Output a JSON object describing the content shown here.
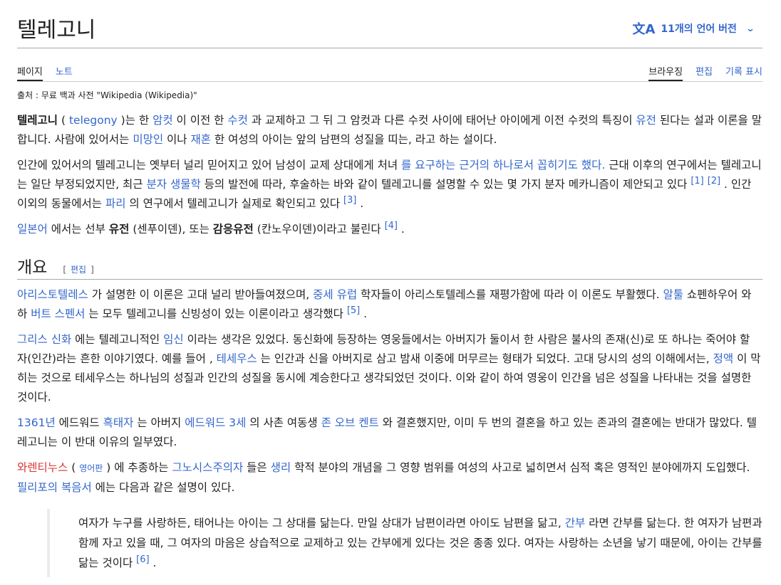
{
  "article": {
    "title": "텔레고니",
    "lang_icon": "文A",
    "lang_label": "11개의 언어 버전",
    "lang_chevron": "⌄"
  },
  "tabs": {
    "left": [
      "페이지",
      "노트"
    ],
    "right": [
      "브라우징",
      "편집",
      "기록 표시"
    ]
  },
  "from": "출처 : 무료 백과 사전 \"Wikipedia (Wikipedia)\"",
  "intro": {
    "p1": {
      "term": "텔레고니",
      "s1": " ( ",
      "l1": "telegony",
      "s2": " )는 한 ",
      "l2": "암컷",
      "s3": " 이 이전 한 ",
      "l3": "수컷",
      "s4": " 과 교제하고 그 뒤 그 암컷과 다른 수컷 사이에 태어난 아이에게 이전 수컷의 특징이 ",
      "l4": "유전",
      "s5": " 된다는 설과 이론을 말합니다. 사람에 있어서는 ",
      "l5": "미망인",
      "s6": " 이나 ",
      "l6": "재혼",
      "s7": " 한 여성의 아이는 앞의 남편의 성질을 띠는, 라고 하는 설이다."
    },
    "p2": {
      "s1": "인간에 있어서의 텔레고니는 옛부터 널리 믿어지고 있어 남성이 교제 상대에게 처녀 ",
      "l1": "를 요구하는 근거의 하나로서 꼽히기도 했다.",
      "s2": " 근대 이후의 연구에서는 텔레고니는 일단 부정되었지만, 최근 ",
      "l2": "분자 생물학",
      "s3": " 등의 발전에 따라, 후술하는 바와 같이 텔레고니를 설명할 수 있는 몇 가지 분자 메카니즘이 제안되고 있다 ",
      "r1": "[1]",
      "r2": "[2]",
      "s4": " . 인간 이외의 동물에서는 ",
      "l3": "파리",
      "s5": " 의 연구에서 텔레고니가 실제로 확인되고 있다 ",
      "r3": "[3]",
      "s6": " ."
    },
    "p3": {
      "l1": "일본어",
      "s1": " 에서는 선부 ",
      "b1": "유전",
      "s2": " (센푸이덴), 또는 ",
      "b2": "감응유전",
      "s3": " (칸노우이덴)이라고 불린다 ",
      "r1": "[4]",
      "s4": " ."
    }
  },
  "section": {
    "title": "개요",
    "edit_open": "[",
    "edit": "편집",
    "edit_close": "]",
    "p1": {
      "l1": "아리스토텔레스",
      "s1": " 가 설명한 이 이론은 고대 널리 받아들여졌으며, ",
      "l2": "중세 유럽",
      "s2": " 학자들이 아리스토텔레스를 재평가함에 따라 이 이론도 부활했다. ",
      "l3": "알툴",
      "s3": " 쇼펜하우어 와 하 ",
      "l4": "버트 스펜서",
      "s4": " 는 모두 텔레고니를 신빙성이 있는 이론이라고 생각했다 ",
      "r1": "[5]",
      "s5": " ."
    },
    "p2": {
      "l1": "그리스 신화",
      "s1": " 에는 텔레고니적인 ",
      "l2": "임신",
      "s2": " 이라는 생각은 있었다. 동신화에 등장하는 영웅들에서는 아버지가 둘이서 한 사람은 불사의 존재(신)로 또 하나는 죽어야 할 자(인간)라는 흔한 이야기였다. 예를 들어 , ",
      "l3": "테세우스",
      "s3": " 는 인간과 신을 아버지로 삼고 밤새 이중에 머무르는 형태가 되었다. 고대 당시의 성의 이해에서는, ",
      "l4": "정액",
      "s4": " 이 막히는 것으로 테세우스는 하나님의 성질과 인간의 성질을 동시에 계승한다고 생각되었던 것이다. 이와 같이 하여 영웅이 인간을 넘은 성질을 나타내는 것을 설명한 것이다."
    },
    "p3": {
      "l1": "1361년",
      "s1": " 에드워드 ",
      "l2": "흑태자",
      "s2": " 는 아버지 ",
      "l3": "에드워드 3세",
      "s3": " 의 사촌 여동생 ",
      "l4": "존 오브 켄트",
      "s4": " 와 결혼했지만, 이미 두 번의 결혼을 하고 있는 존과의 결혼에는 반대가 많았다. 텔레고니는 이 반대 이유의 일부였다."
    },
    "p4": {
      "red1": "와렌티누스",
      "s0": " ( ",
      "small1": "영어판",
      "s0b": " ) 에 추종하는 ",
      "l1": "그노시스주의자",
      "s1": " 들은 ",
      "l2": "생리",
      "s2": " 학적 분야의 개념을 그 영향 범위를 여성의 사고로 넓히면서 심적 혹은 영적인 분야에까지 도입했다. ",
      "l3": "필리포의 복음서",
      "s3": " 에는 다음과 같은 설명이 있다."
    },
    "quote": {
      "s1": "여자가 누구를 사랑하든, 태어나는 아이는 그 상대를 닮는다. 만일 상대가 남편이라면 아이도 남편을 닮고, ",
      "l1": "간부",
      "s2": " 라면 간부를 닮는다. 한 여자가 남편과 함께 자고 있을 때, 그 여자의 마음은 상습적으로 교제하고 있는 간부에게 있다는 것은 종종 있다. 여자는 사랑하는 소년을 낳기 때문에, 아이는 간부를 닮는 것이다 ",
      "r1": "[6]",
      "s3": " ."
    }
  }
}
